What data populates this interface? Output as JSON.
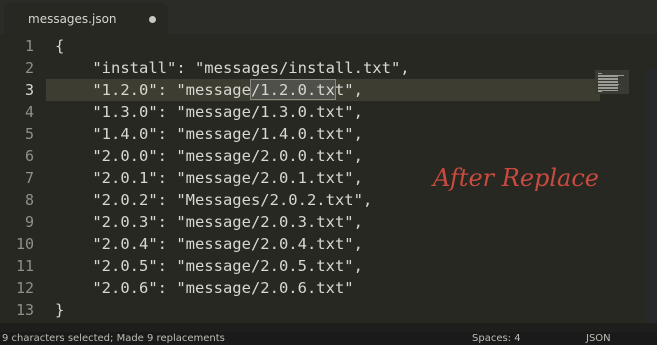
{
  "tab": {
    "title": "messages.json"
  },
  "editor": {
    "line_numbers": [
      "1",
      "2",
      "3",
      "4",
      "5",
      "6",
      "7",
      "8",
      "9",
      "10",
      "11",
      "12",
      "13"
    ],
    "active_line": 3,
    "lines": [
      "{",
      "    \"install\": \"messages/install.txt\",",
      "    \"1.2.0\": \"message/1.2.0.txt\",",
      "    \"1.3.0\": \"message/1.3.0.txt\",",
      "    \"1.4.0\": \"message/1.4.0.txt\",",
      "    \"2.0.0\": \"message/2.0.0.txt\",",
      "    \"2.0.1\": \"message/2.0.1.txt\",",
      "    \"2.0.2\": \"Messages/2.0.2.txt\",",
      "    \"2.0.3\": \"message/2.0.3.txt\",",
      "    \"2.0.4\": \"message/2.0.4.txt\",",
      "    \"2.0.5\": \"message/2.0.5.txt\",",
      "    \"2.0.6\": \"message/2.0.6.txt\"",
      "}"
    ],
    "selected_text": "message/1"
  },
  "annotation": "After Replace",
  "statusbar": {
    "message": "9 characters selected; Made 9 replacements",
    "spaces": "Spaces: 4",
    "syntax": "JSON"
  }
}
